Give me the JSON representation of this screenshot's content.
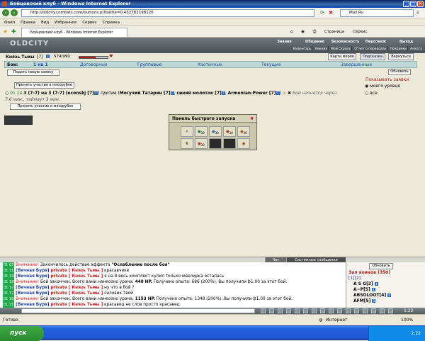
{
  "window": {
    "title": "Бойцовский клуб - Windows Internet Explorer",
    "address": "http://oldcity.combats.com/buttons.pl?battle=0.432782198126",
    "search_text": "Mail.Ru"
  },
  "menu": [
    "Файл",
    "Правка",
    "Вид",
    "Избранное",
    "Сервис",
    "Справка"
  ],
  "toolbar": {
    "page": "Страница",
    "service": "Сервис"
  },
  "game": {
    "logo": "OLDCITY",
    "topnav": [
      "Знания",
      "Общение",
      "Безопасность",
      "Персонаж",
      "Выход"
    ],
    "subnav": [
      "Инвентарь",
      "Умения",
      "Мой Скролл",
      "Отчет о переводах",
      "Поединки",
      "Анкета"
    ]
  },
  "player": {
    "name": "Князь Тьмы",
    "level": "[7]",
    "hp": "574/990",
    "hp_fraction": 0.58
  },
  "buttons": {
    "map": "Карта миров",
    "hint": "Подсказка",
    "return": "Вернуться",
    "new_request": "Подать новую заявку",
    "refresh": "Обновить",
    "join1": "Принять участие в мясорубке",
    "join2": "Принять участие в мясорубке"
  },
  "tabs": [
    "Бои:",
    "1 на 1",
    "Договорные",
    "Групповые",
    "Хаотичные",
    "Текущие",
    "Завершенные"
  ],
  "show_requests": {
    "title": "Показывать заявки",
    "opt1": "моего уровня",
    "opt2": "все"
  },
  "battle": {
    "time": "01 14",
    "text_a": "3 (7-7) на 3 (7-7)",
    "p1": "(econskj [7]",
    "vs": "против",
    "p2": "Могучий Татарин [7]",
    "p3": "синий молоток [7]",
    "p4": "Armenian-Power [7]",
    "after": "Бой начнется через",
    "timer": "7.6 мин., таймаут 3 мин."
  },
  "panel": {
    "title": "Панель быстрого запуска",
    "items": [
      "30",
      "30",
      "30",
      "30"
    ],
    "row2": [
      "6",
      "30",
      "",
      "",
      ""
    ]
  },
  "chat_tabs": [
    "Чат",
    "Системные сообщения"
  ],
  "chat": [
    {
      "ts": "01 07",
      "pre": "Внимание!",
      "text": "Закончилось действие эффекта",
      "bold": "\"Ослабление после боя\""
    },
    {
      "ts": "01 11",
      "nick": "[Вечная Буря]",
      "priv": "private [ Князь Тьмы ]",
      "text": "красавчике"
    },
    {
      "ts": "01 13",
      "nick": "[Вечная Буря]",
      "priv": "private [ Князь Тьмы ]",
      "text": "я на 8 весь комплект купил только ювелирка осталась"
    },
    {
      "ts": "01 15",
      "pre": "Внимание!",
      "text": "Бой закончен. Всего вами нанесено урона:",
      "bold": "440 HP.",
      "tail": "Получено опыта: 686 (200%). Вы получили ₿1.00 за этот бой."
    },
    {
      "ts": "01 17",
      "nick": "[Вечная Буря]",
      "priv": "private [ Князь Тьмы ]",
      "text": "ну что в бой ?"
    },
    {
      "ts": "01 17",
      "nick": "[Вечная Буря]",
      "priv": "private [ Князь Тьмы ]",
      "text": "силовик твой"
    },
    {
      "ts": "01 19",
      "pre": "Внимание!",
      "text": "Бой закончен. Всего вами нанесено урона:",
      "bold": "1153 HP.",
      "tail": "Получено опыта: 1348 (200%). Вы получили ₿1.00 за этот бой."
    },
    {
      "ts": "01 21",
      "nick": "[Вечная Буря]",
      "priv": "private [ Князь Тьмы ]",
      "text": "красавец не слов просто красавец"
    }
  ],
  "who": {
    "refresh": "Обновить",
    "title": "Зал воинов (350)",
    "pages": "[1][2]",
    "names": [
      "A S G[2]",
      "A~P[5]",
      "ABSOLOOT[4]",
      "AFM[5]"
    ]
  },
  "status": {
    "ready": "Готово",
    "internet": "Интернет",
    "zoom": "100%"
  },
  "taskbar": {
    "start": "пуск",
    "clock": "2:22"
  },
  "game_clock": "1:22"
}
